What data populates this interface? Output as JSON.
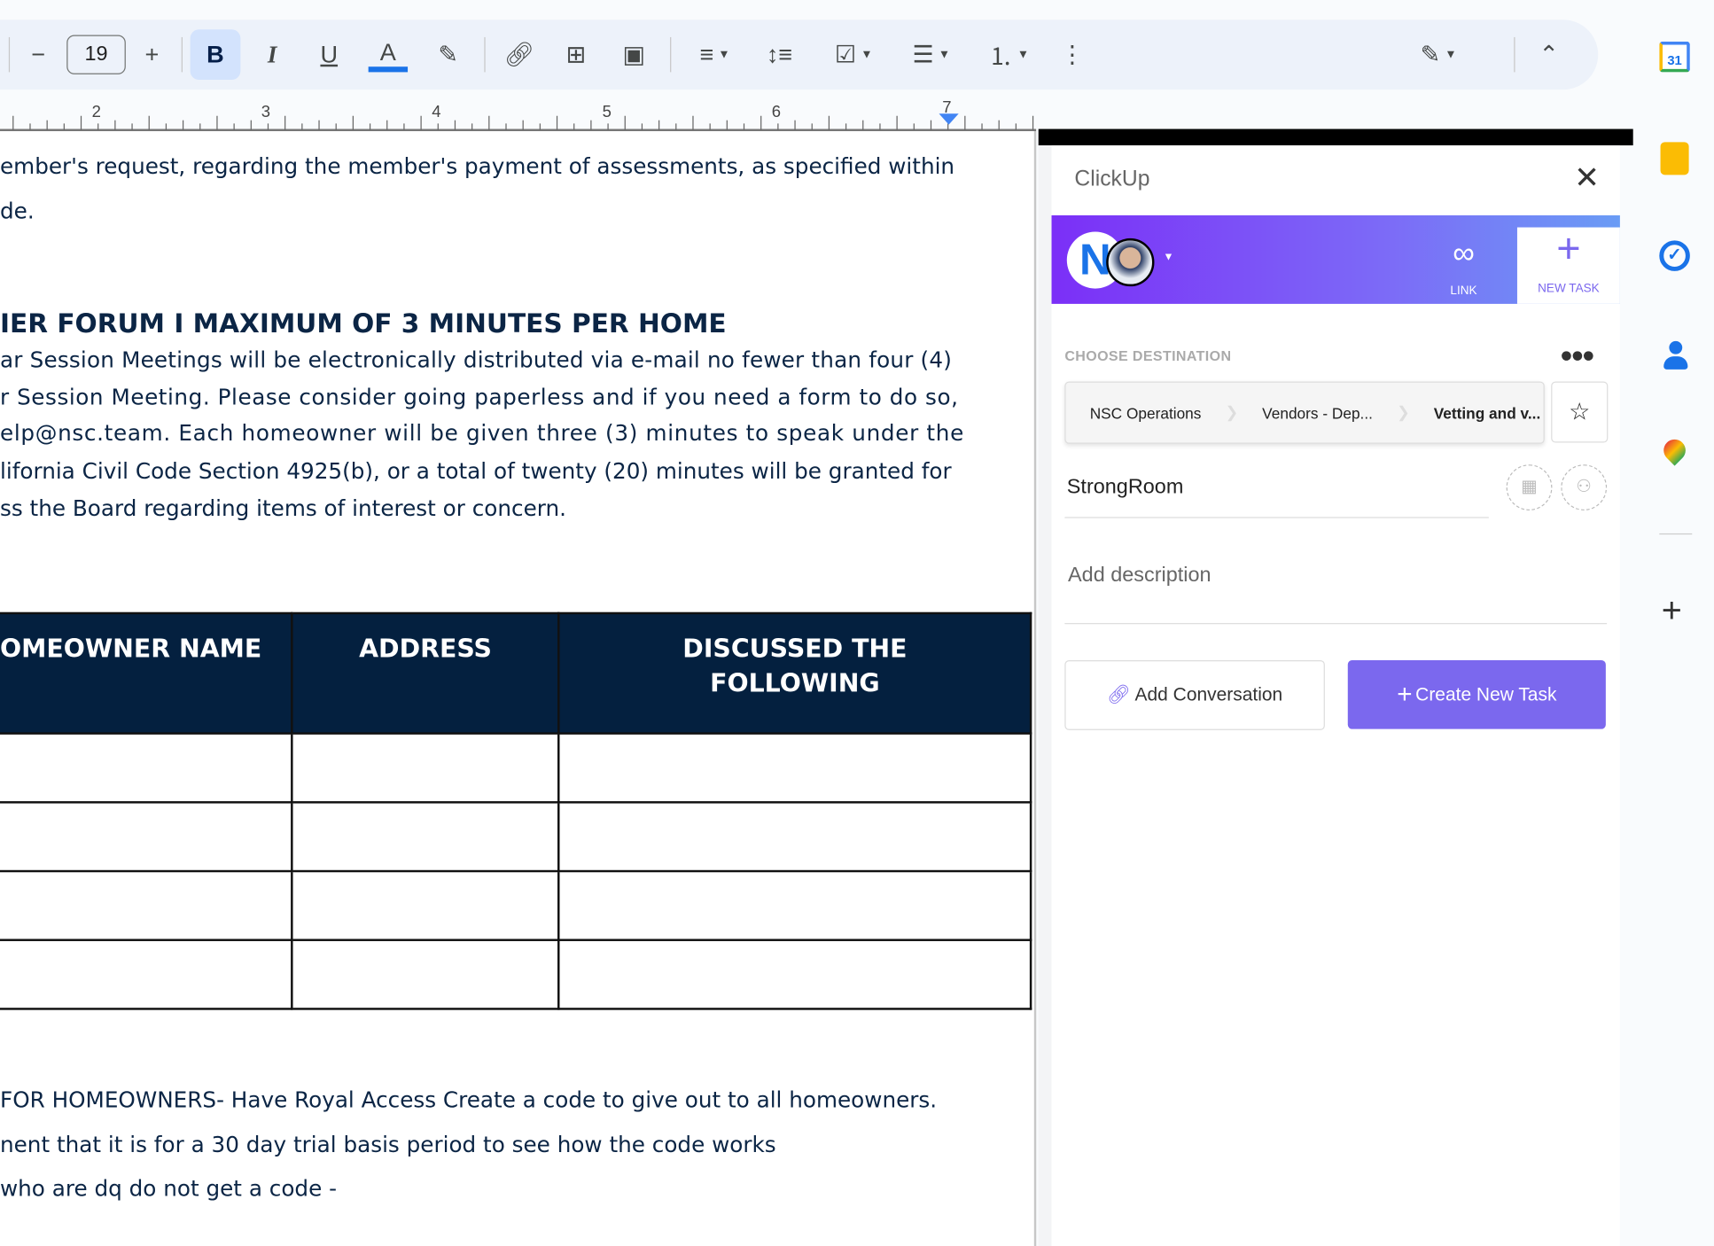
{
  "toolbar": {
    "font_size": "19",
    "bold": "B",
    "italic": "I",
    "underline": "U",
    "text_color": "A",
    "text_color_hex": "#1a73e8"
  },
  "ruler": {
    "marks": [
      "2",
      "3",
      "4",
      "5",
      "6",
      "7"
    ]
  },
  "document": {
    "lines1": [
      "ember's request, regarding the member's payment of assessments, as specified within",
      "de."
    ],
    "heading": "IER FORUM I MAXIMUM OF 3 MINUTES PER HOME",
    "para": [
      "ar Session Meetings will be electronically distributed via e-mail no fewer than four (4)",
      "r Session Meeting. Please consider going paperless and if you need a form to do so,",
      "elp@nsc.team. Each homeowner will be given three (3) minutes to speak under the",
      "lifornia Civil Code Section 4925(b), or a total of twenty (20) minutes will be granted for",
      "ss the Board regarding items of interest or concern."
    ],
    "table": {
      "headers": [
        "OMEOWNER NAME",
        "ADDRESS",
        "DISCUSSED THE FOLLOWING"
      ],
      "rows": 4
    },
    "lines2": [
      " FOR HOMEOWNERS- Have Royal Access Create a code to give out to all homeowners.",
      "nent that it is for a 30 day trial basis period to see how the code works",
      "who are dq do not get a code -"
    ]
  },
  "clickup": {
    "title": "ClickUp",
    "link_label": "LINK",
    "new_task_label": "NEW TASK",
    "choose_destination": "CHOOSE DESTINATION",
    "breadcrumbs": [
      "NSC Operations",
      "Vendors - Dep...",
      "Vetting and v..."
    ],
    "task_name": "StrongRoom",
    "description_placeholder": "Add description",
    "add_conversation": "Add Conversation",
    "create_task": "Create New Task",
    "accent": "#7b68ee"
  },
  "sidebar": {
    "apps": [
      "calendar-icon",
      "keep-icon",
      "tasks-icon",
      "contacts-icon",
      "maps-icon"
    ],
    "calendar_day": "31",
    "add": "+"
  }
}
